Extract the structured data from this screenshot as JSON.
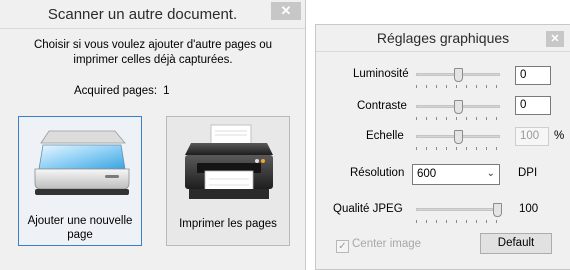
{
  "scanner": {
    "title": "Scanner un autre document.",
    "close_glyph": "✕",
    "message_line1": "Choisir si vous voulez ajouter d'autre pages ou",
    "message_line2": "imprimer celles déjà capturées.",
    "acquired_label": "Acquired pages:",
    "acquired_count": "1",
    "add_button": {
      "line1": "Ajouter une nouvelle",
      "line2": "page",
      "icon": "scanner-icon"
    },
    "print_button": {
      "label": "Imprimer les pages",
      "icon": "printer-icon"
    }
  },
  "graphics": {
    "title": "Réglages graphiques",
    "close_glyph": "✕",
    "brightness": {
      "label": "Luminosité",
      "value": "0",
      "level": 0.5
    },
    "contrast": {
      "label": "Contraste",
      "value": "0",
      "level": 0.5
    },
    "scale": {
      "label": "Echelle",
      "value": "100",
      "unit": "%",
      "level": 0.5
    },
    "resolution": {
      "label": "Résolution",
      "selected": "600",
      "unit": "DPI"
    },
    "jpeg": {
      "label": "Qualité JPEG",
      "value": "100",
      "level": 1.0
    },
    "center_image": {
      "label": "Center image",
      "checked": true,
      "check_glyph": "✓"
    },
    "default_button": "Default"
  },
  "colors": {
    "selected_border": "#3c7fc6",
    "window_bg": "#f0f0f0",
    "close_bg": "#c7c7c7"
  }
}
